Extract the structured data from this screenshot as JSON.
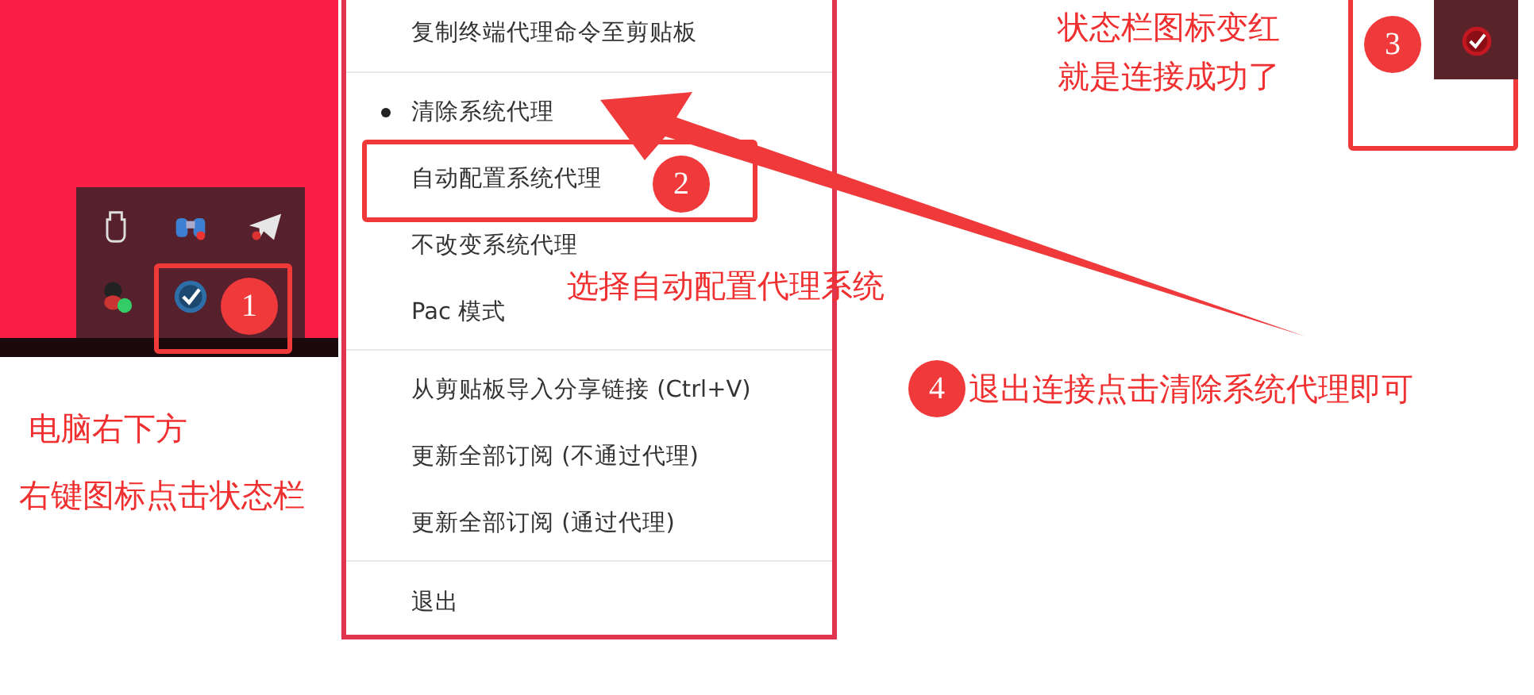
{
  "menu": {
    "groups": [
      [
        {
          "label": "复制终端代理命令至剪贴板",
          "checked": false
        }
      ],
      [
        {
          "label": "清除系统代理",
          "checked": true
        },
        {
          "label": "自动配置系统代理",
          "checked": false
        },
        {
          "label": "不改变系统代理",
          "checked": false
        },
        {
          "label": "Pac 模式",
          "checked": false
        }
      ],
      [
        {
          "label": "从剪贴板导入分享链接 (Ctrl+V)",
          "checked": false
        },
        {
          "label": "更新全部订阅 (不通过代理)",
          "checked": false
        },
        {
          "label": "更新全部订阅 (通过代理)",
          "checked": false
        }
      ],
      [
        {
          "label": "退出",
          "checked": false
        }
      ]
    ]
  },
  "badges": [
    "1",
    "2",
    "3",
    "4"
  ],
  "notes": [
    "选择自动配置代理系统",
    "电脑右下方",
    "右键图标点击状态栏",
    "状态栏图标变红",
    "就是连接成功了",
    "退出连接点击清除系统代理即可"
  ]
}
